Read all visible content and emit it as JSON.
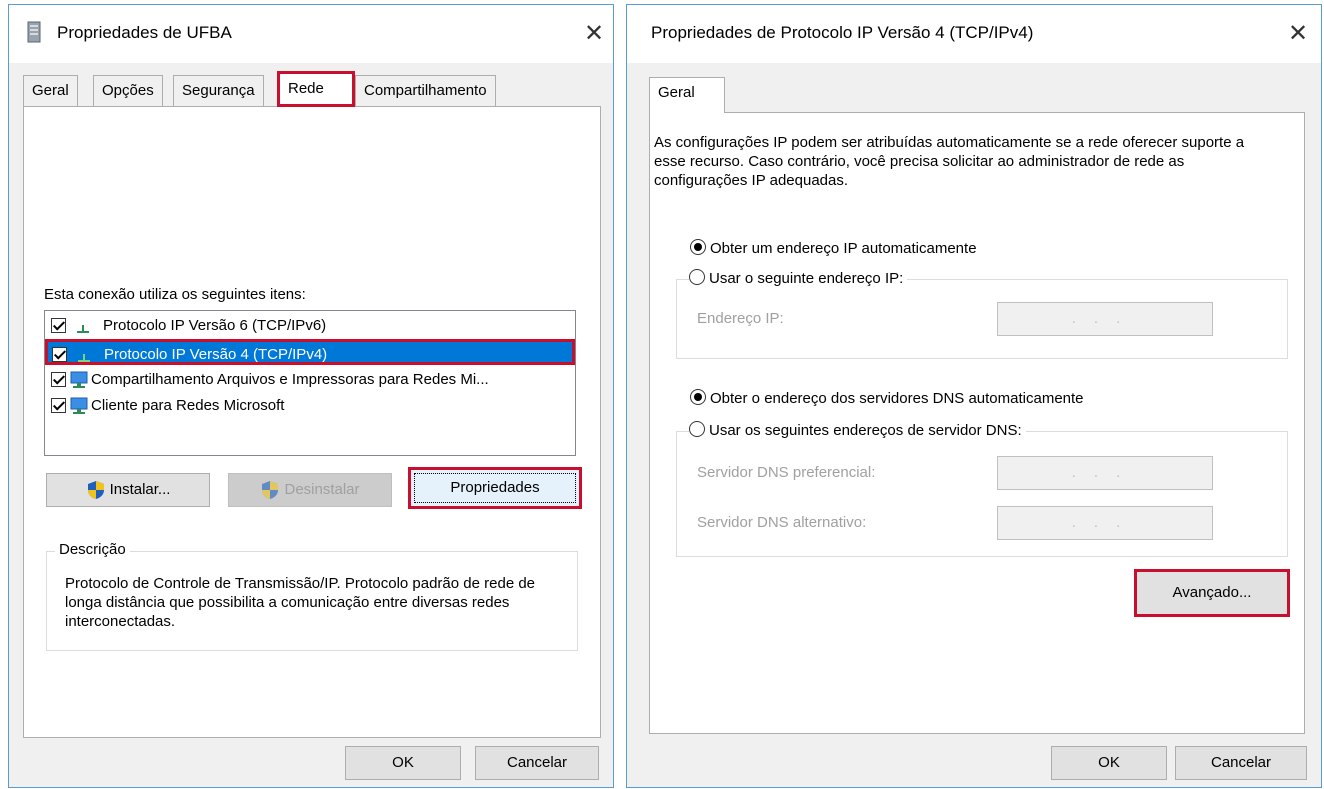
{
  "left_dialog": {
    "title": "Propriedades de UFBA",
    "close_glyph": "✕",
    "tabs": [
      "Geral",
      "Opções",
      "Segurança",
      "Rede",
      "Compartilhamento"
    ],
    "active_tab": "Rede",
    "items_label": "Esta conexão utiliza os seguintes itens:",
    "items": [
      {
        "label": "Protocolo IP Versão 6 (TCP/IPv6)",
        "checked": true,
        "icon": "network-protocol-icon"
      },
      {
        "label": "Protocolo IP Versão 4 (TCP/IPv4)",
        "checked": true,
        "icon": "network-protocol-icon",
        "selected": true
      },
      {
        "label": "Compartilhamento Arquivos e Impressoras para Redes Mi...",
        "checked": true,
        "icon": "network-computer-icon"
      },
      {
        "label": "Cliente para Redes Microsoft",
        "checked": true,
        "icon": "network-computer-icon"
      }
    ],
    "install_label": "Instalar...",
    "uninstall_label": "Desinstalar",
    "properties_label": "Propriedades",
    "description_title": "Descrição",
    "description_text": "Protocolo de Controle de Transmissão/IP. Protocolo padrão de rede de longa distância que possibilita a comunicação entre diversas redes interconectadas.",
    "ok_label": "OK",
    "cancel_label": "Cancelar"
  },
  "right_dialog": {
    "title": "Propriedades de Protocolo IP Versão 4 (TCP/IPv4)",
    "close_glyph": "✕",
    "tab": "Geral",
    "intro_text": "As configurações IP podem ser atribuídas automaticamente se a rede oferecer suporte a esse recurso. Caso contrário, você precisa solicitar ao administrador de rede as configurações IP adequadas.",
    "ip_auto_label": "Obter um endereço IP automaticamente",
    "ip_manual_label": "Usar o seguinte endereço IP:",
    "ip_address_label": "Endereço IP:",
    "dns_auto_label": "Obter o endereço dos servidores DNS automaticamente",
    "dns_manual_label": "Usar os seguintes endereços de servidor DNS:",
    "dns_preferred_label": "Servidor DNS preferencial:",
    "dns_alternate_label": "Servidor DNS alternativo:",
    "ip_placeholder": "...",
    "advanced_label": "Avançado...",
    "ok_label": "OK",
    "cancel_label": "Cancelar"
  },
  "colors": {
    "highlight_frame": "#c8102e",
    "selection": "#0078d7",
    "window_border": "#5b9bd5"
  }
}
